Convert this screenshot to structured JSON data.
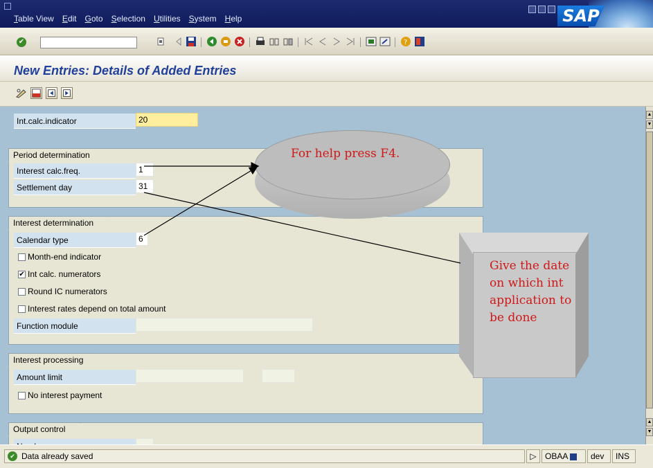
{
  "window": {
    "menu": [
      "Table View",
      "Edit",
      "Goto",
      "Selection",
      "Utilities",
      "System",
      "Help"
    ],
    "logo": "SAP"
  },
  "page": {
    "title": "New Entries: Details of Added Entries"
  },
  "fields": {
    "int_calc_indicator": {
      "label": "Int.calc.indicator",
      "value": "20"
    }
  },
  "groups": {
    "period": {
      "title": "Period determination",
      "interest_calc_freq": {
        "label": "Interest calc.freq.",
        "value": "1"
      },
      "settlement_day": {
        "label": "Settlement day",
        "value": "31"
      }
    },
    "interest": {
      "title": "Interest determination",
      "calendar_type": {
        "label": "Calendar type",
        "value": "6"
      },
      "month_end": {
        "label": "Month-end indicator",
        "checked": false
      },
      "int_calc_numerators": {
        "label": "Int calc. numerators",
        "checked": true
      },
      "round_ic": {
        "label": "Round IC numerators",
        "checked": false
      },
      "rates_depend": {
        "label": "Interest rates depend on total amount",
        "checked": false
      },
      "function_module": {
        "label": "Function module",
        "value": ""
      }
    },
    "processing": {
      "title": "Interest processing",
      "amount_limit": {
        "label": "Amount limit",
        "value": "",
        "currency": ""
      },
      "no_interest_payment": {
        "label": "No interest payment",
        "checked": false
      }
    },
    "output": {
      "title": "Output control",
      "partial_label": "Number"
    }
  },
  "callouts": {
    "help": "For help press F4.",
    "date": "Give the date on which int application to be done"
  },
  "status": {
    "message": "Data already saved",
    "transaction": "OBAA",
    "system": "dev",
    "mode": "INS"
  },
  "icons": {
    "enter": "check-icon",
    "save": "floppy-icon",
    "back": "back-icon",
    "exit": "exit-icon",
    "cancel": "cancel-icon",
    "print": "print-icon",
    "find": "find-icon",
    "help": "help-icon"
  }
}
